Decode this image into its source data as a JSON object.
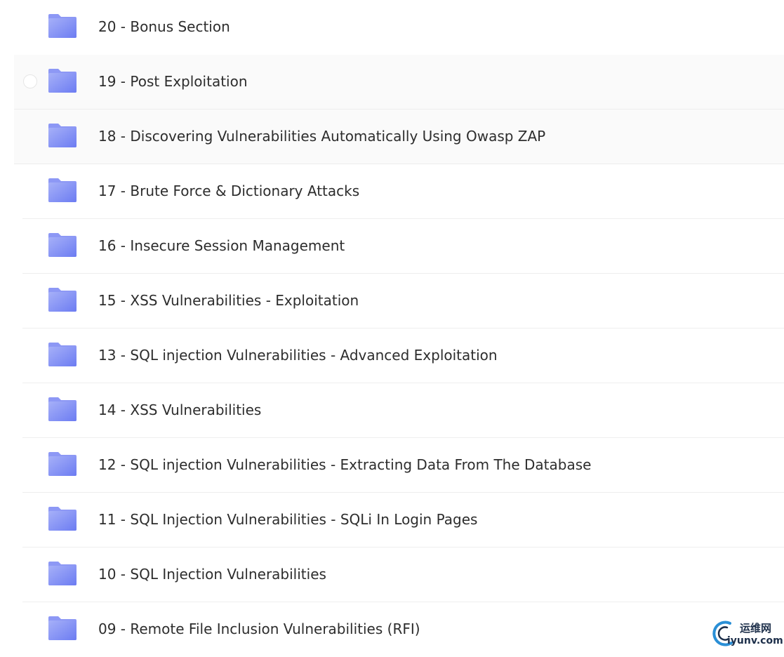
{
  "folders": [
    {
      "name": "20 - Bonus Section"
    },
    {
      "name": "19 - Post Exploitation"
    },
    {
      "name": "18 - Discovering Vulnerabilities Automatically Using Owasp ZAP"
    },
    {
      "name": "17 - Brute Force & Dictionary Attacks"
    },
    {
      "name": "16 - Insecure Session Management"
    },
    {
      "name": "15 - XSS Vulnerabilities - Exploitation"
    },
    {
      "name": "13 - SQL injection Vulnerabilities - Advanced Exploitation"
    },
    {
      "name": "14 - XSS Vulnerabilities"
    },
    {
      "name": "12 - SQL injection Vulnerabilities - Extracting Data From The Database"
    },
    {
      "name": "11 - SQL Injection Vulnerabilities - SQLi In Login Pages"
    },
    {
      "name": "10 - SQL Injection Vulnerabilities"
    },
    {
      "name": "09 - Remote File Inclusion Vulnerabilities (RFI)"
    }
  ],
  "icons": {
    "folder": "folder-icon",
    "checkbox": "checkbox-icon",
    "watermark_logo": "watermark-logo-icon"
  },
  "colors": {
    "folder_top": "#9aa6f7",
    "folder_bottom": "#6f7ff3",
    "text": "#2d2d2d",
    "hover_bg": "#fafafa"
  },
  "watermark": {
    "site_cn": "运维网",
    "site_url": "iyunv.com"
  }
}
